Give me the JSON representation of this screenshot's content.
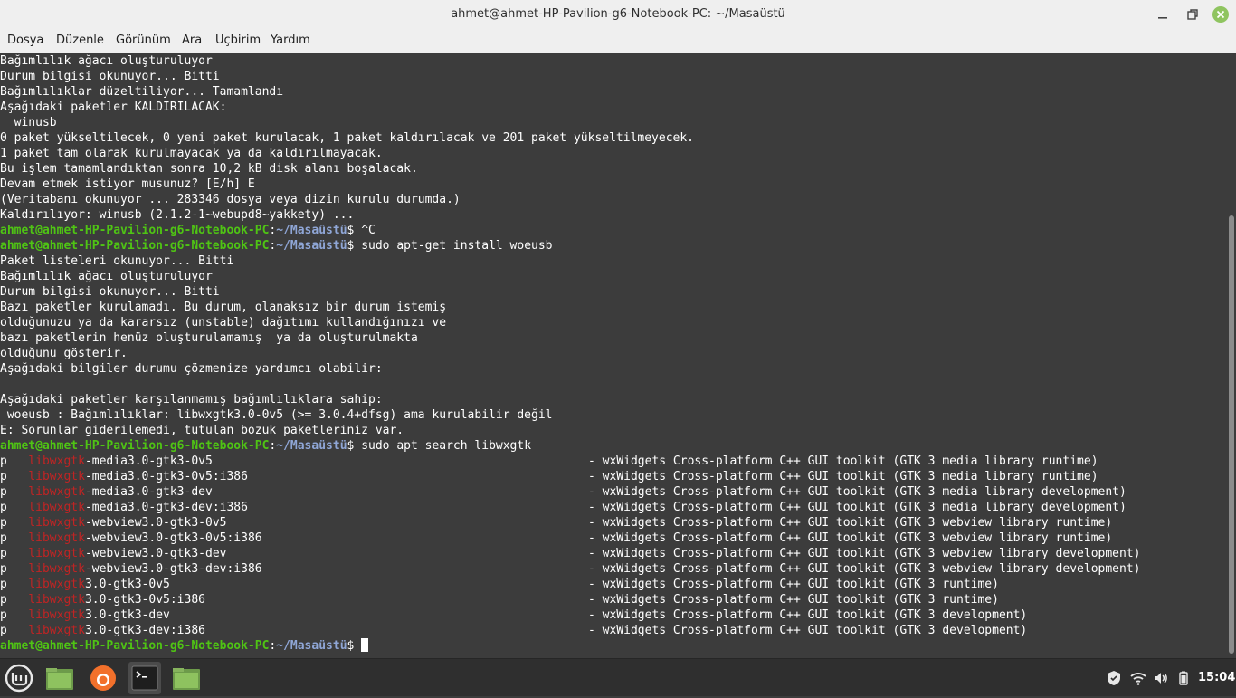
{
  "window": {
    "title": "ahmet@ahmet-HP-Pavilion-g6-Notebook-PC: ~/Masaüstü"
  },
  "menu": {
    "items": [
      "Dosya",
      "Düzenle",
      "Görünüm",
      "Ara",
      "Uçbirim",
      "Yardım"
    ]
  },
  "prompt": {
    "user": "ahmet@ahmet-HP-Pavilion-g6-Notebook-PC",
    "colon": ":",
    "path": "~/Masaüstü",
    "symbol": "$ "
  },
  "terminal": {
    "lines": [
      {
        "type": "text",
        "text": "Bağımlılık ağacı oluşturuluyor"
      },
      {
        "type": "text",
        "text": "Durum bilgisi okunuyor... Bitti"
      },
      {
        "type": "text",
        "text": "Bağımlılıklar düzeltiliyor... Tamamlandı"
      },
      {
        "type": "text",
        "text": "Aşağıdaki paketler KALDIRILACAK:"
      },
      {
        "type": "text",
        "text": "  winusb"
      },
      {
        "type": "text",
        "text": "0 paket yükseltilecek, 0 yeni paket kurulacak, 1 paket kaldırılacak ve 201 paket yükseltilmeyecek."
      },
      {
        "type": "text",
        "text": "1 paket tam olarak kurulmayacak ya da kaldırılmayacak."
      },
      {
        "type": "text",
        "text": "Bu işlem tamamlandıktan sonra 10,2 kB disk alanı boşalacak."
      },
      {
        "type": "text",
        "text": "Devam etmek istiyor musunuz? [E/h] E"
      },
      {
        "type": "text",
        "text": "(Veritabanı okunuyor ... 283346 dosya veya dizin kurulu durumda.)"
      },
      {
        "type": "text",
        "text": "Kaldırılıyor: winusb (2.1.2-1~webupd8~yakkety) ..."
      },
      {
        "type": "prompt",
        "cmd": "^C"
      },
      {
        "type": "prompt",
        "cmd": "sudo apt-get install woeusb"
      },
      {
        "type": "text",
        "text": "Paket listeleri okunuyor... Bitti"
      },
      {
        "type": "text",
        "text": "Bağımlılık ağacı oluşturuluyor"
      },
      {
        "type": "text",
        "text": "Durum bilgisi okunuyor... Bitti"
      },
      {
        "type": "text",
        "text": "Bazı paketler kurulamadı. Bu durum, olanaksız bir durum istemiş"
      },
      {
        "type": "text",
        "text": "olduğunuzu ya da kararsız (unstable) dağıtımı kullandığınızı ve"
      },
      {
        "type": "text",
        "text": "bazı paketlerin henüz oluşturulamamış  ya da oluşturulmakta"
      },
      {
        "type": "text",
        "text": "olduğunu gösterir."
      },
      {
        "type": "text",
        "text": "Aşağıdaki bilgiler durumu çözmenize yardımcı olabilir:"
      },
      {
        "type": "text",
        "text": ""
      },
      {
        "type": "text",
        "text": "Aşağıdaki paketler karşılanmamış bağımlılıklara sahip:"
      },
      {
        "type": "text",
        "text": " woeusb : Bağımlılıklar: libwxgtk3.0-0v5 (>= 3.0.4+dfsg) ama kurulabilir değil"
      },
      {
        "type": "text",
        "text": "E: Sorunlar giderilemedi, tutulan bozuk paketleriniz var."
      },
      {
        "type": "prompt",
        "cmd": "sudo apt search libwxgtk"
      },
      {
        "type": "pkg",
        "status": "p",
        "hl": "libwxgtk",
        "rest": "-media3.0-gtk3-0v5",
        "desc": "- wxWidgets Cross-platform C++ GUI toolkit (GTK 3 media library runtime)"
      },
      {
        "type": "pkg",
        "status": "p",
        "hl": "libwxgtk",
        "rest": "-media3.0-gtk3-0v5:i386",
        "desc": "- wxWidgets Cross-platform C++ GUI toolkit (GTK 3 media library runtime)"
      },
      {
        "type": "pkg",
        "status": "p",
        "hl": "libwxgtk",
        "rest": "-media3.0-gtk3-dev",
        "desc": "- wxWidgets Cross-platform C++ GUI toolkit (GTK 3 media library development)"
      },
      {
        "type": "pkg",
        "status": "p",
        "hl": "libwxgtk",
        "rest": "-media3.0-gtk3-dev:i386",
        "desc": "- wxWidgets Cross-platform C++ GUI toolkit (GTK 3 media library development)"
      },
      {
        "type": "pkg",
        "status": "p",
        "hl": "libwxgtk",
        "rest": "-webview3.0-gtk3-0v5",
        "desc": "- wxWidgets Cross-platform C++ GUI toolkit (GTK 3 webview library runtime)"
      },
      {
        "type": "pkg",
        "status": "p",
        "hl": "libwxgtk",
        "rest": "-webview3.0-gtk3-0v5:i386",
        "desc": "- wxWidgets Cross-platform C++ GUI toolkit (GTK 3 webview library runtime)"
      },
      {
        "type": "pkg",
        "status": "p",
        "hl": "libwxgtk",
        "rest": "-webview3.0-gtk3-dev",
        "desc": "- wxWidgets Cross-platform C++ GUI toolkit (GTK 3 webview library development)"
      },
      {
        "type": "pkg",
        "status": "p",
        "hl": "libwxgtk",
        "rest": "-webview3.0-gtk3-dev:i386",
        "desc": "- wxWidgets Cross-platform C++ GUI toolkit (GTK 3 webview library development)"
      },
      {
        "type": "pkg",
        "status": "p",
        "hl": "libwxgtk",
        "rest": "3.0-gtk3-0v5",
        "desc": "- wxWidgets Cross-platform C++ GUI toolkit (GTK 3 runtime)"
      },
      {
        "type": "pkg",
        "status": "p",
        "hl": "libwxgtk",
        "rest": "3.0-gtk3-0v5:i386",
        "desc": "- wxWidgets Cross-platform C++ GUI toolkit (GTK 3 runtime)"
      },
      {
        "type": "pkg",
        "status": "p",
        "hl": "libwxgtk",
        "rest": "3.0-gtk3-dev",
        "desc": "- wxWidgets Cross-platform C++ GUI toolkit (GTK 3 development)"
      },
      {
        "type": "pkg",
        "status": "p",
        "hl": "libwxgtk",
        "rest": "3.0-gtk3-dev:i386",
        "desc": "- wxWidgets Cross-platform C++ GUI toolkit (GTK 3 development)"
      },
      {
        "type": "prompt",
        "cmd": "",
        "cursor": true
      }
    ]
  },
  "taskbar": {
    "apps": [
      "menu-icon",
      "files-icon",
      "firefox-icon",
      "terminal-icon",
      "folder-icon"
    ],
    "tray": [
      "shield-icon",
      "wifi-icon",
      "volume-icon",
      "battery-icon"
    ],
    "clock": "15:04"
  },
  "colors": {
    "terminal_bg": "#3c3c3c",
    "prompt_user": "#4fc414",
    "prompt_path": "#8fa6d6",
    "highlight": "#c02424",
    "close_button": "#8fc460"
  }
}
